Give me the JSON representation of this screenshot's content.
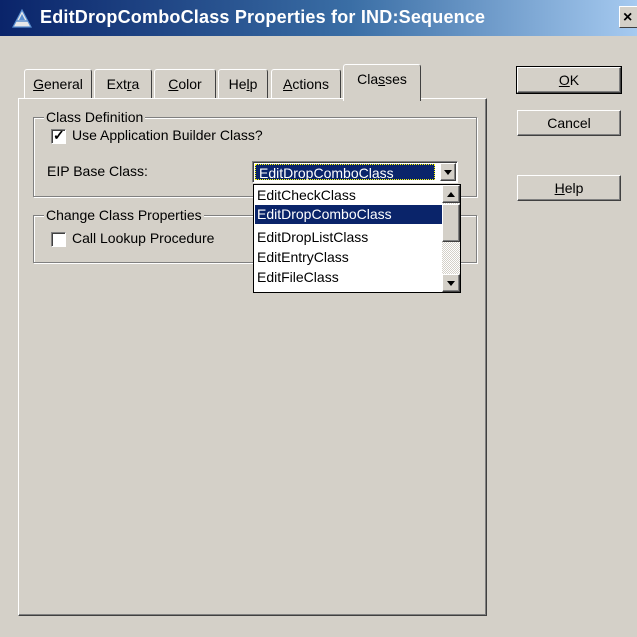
{
  "window": {
    "title": "EditDropComboClass Properties for IND:Sequence",
    "close_glyph": "×"
  },
  "tabs": [
    {
      "pre": "",
      "key": "G",
      "post": "eneral",
      "active": false
    },
    {
      "pre": "Ext",
      "key": "r",
      "post": "a",
      "active": false
    },
    {
      "pre": "",
      "key": "C",
      "post": "olor",
      "active": false
    },
    {
      "pre": "He",
      "key": "l",
      "post": "p",
      "active": false
    },
    {
      "pre": "",
      "key": "A",
      "post": "ctions",
      "active": false
    },
    {
      "pre": "Cla",
      "key": "s",
      "post": "ses",
      "active": true
    }
  ],
  "class_definition": {
    "group_label": "Class Definition",
    "use_app_builder_label": "Use Application Builder Class?",
    "use_app_builder_checked": true,
    "eip_base_class_label": "EIP Base Class:",
    "eip_base_class_value": "EditDropComboClass"
  },
  "change_class_properties": {
    "group_label": "Change Class Properties",
    "call_lookup_label": "Call Lookup Procedure",
    "call_lookup_checked": false
  },
  "dropdown": {
    "items": [
      "EditCheckClass",
      "EditDropComboClass",
      "EditDropListClass",
      "EditEntryClass",
      "EditFileClass"
    ],
    "selected_index": 1
  },
  "buttons": {
    "ok": {
      "key": "O",
      "post": "K"
    },
    "cancel": {
      "label": "Cancel"
    },
    "help": {
      "key": "H",
      "post": "elp"
    }
  },
  "colors": {
    "dialog_face": "#d4d0c8",
    "selection": "#0a246a",
    "title_gradient_start": "#0a246a",
    "title_gradient_end": "#a6caf0"
  }
}
